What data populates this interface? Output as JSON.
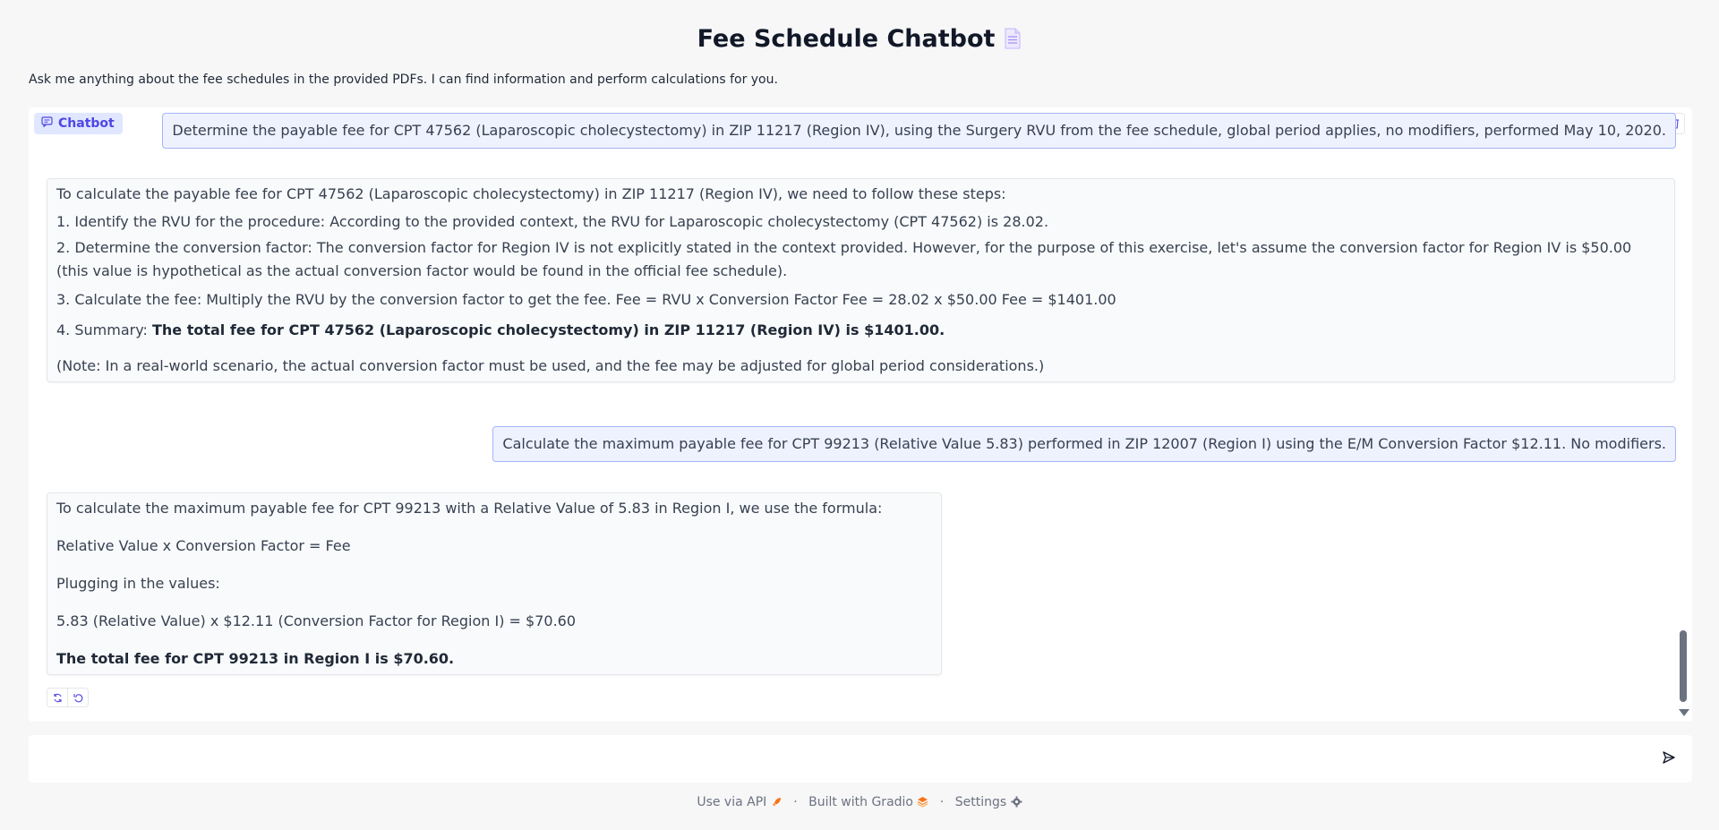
{
  "header": {
    "title": "Fee Schedule Chatbot",
    "doc_icon": "page-facing-up-icon",
    "subtitle": "Ask me anything about the fee schedules in the provided PDFs. I can find information and perform calculations for you."
  },
  "chatbot": {
    "label": "Chatbot",
    "messages": [
      {
        "role": "user",
        "text": "Determine the payable fee for CPT 47562 (Laparoscopic cholecystectomy) in ZIP 11217 (Region IV), using the Surgery RVU from the fee schedule, global period applies, no modifiers, performed May 10, 2020."
      },
      {
        "role": "bot",
        "intro": "To calculate the payable fee for CPT 47562 (Laparoscopic cholecystectomy) in ZIP 11217 (Region IV), we need to follow these steps:",
        "step1": "1. Identify the RVU for the procedure: According to the provided context, the RVU for Laparoscopic cholecystectomy (CPT 47562) is 28.02.",
        "step2": "2. Determine the conversion factor: The conversion factor for Region IV is not explicitly stated in the context provided. However, for the purpose of this exercise, let's assume the conversion factor for Region IV is $50.00 (this value is hypothetical as the actual conversion factor would be found in the official fee schedule).",
        "step3": "3. Calculate the fee: Multiply the RVU by the conversion factor to get the fee. Fee = RVU x Conversion Factor Fee = 28.02 x $50.00 Fee = $1401.00",
        "step4_prefix": "4. Summary: ",
        "step4_bold": "The total fee for CPT 47562 (Laparoscopic cholecystectomy) in ZIP 11217 (Region IV) is $1401.00.",
        "note": "(Note: In a real-world scenario, the actual conversion factor must be used, and the fee may be adjusted for global period considerations.)"
      },
      {
        "role": "user",
        "text": "Calculate the maximum payable fee for CPT 99213 (Relative Value 5.83) performed in ZIP 12007 (Region I) using the E/M Conversion Factor $12.11. No modifiers."
      },
      {
        "role": "bot",
        "line1": "To calculate the maximum payable fee for CPT 99213 with a Relative Value of 5.83 in Region I, we use the formula:",
        "line2": "Relative Value x Conversion Factor = Fee",
        "line3": "Plugging in the values:",
        "line4": "5.83 (Relative Value) x $12.11 (Conversion Factor for Region I) = $70.60",
        "line5_bold": "The total fee for CPT 99213 in Region I is $70.60."
      }
    ]
  },
  "input": {
    "placeholder": "",
    "value": ""
  },
  "footer": {
    "api": "Use via API",
    "built": "Built with Gradio",
    "settings": "Settings",
    "separator": "·"
  },
  "colors": {
    "accent": "#4f46e5",
    "user_bubble_border": "#a5b4fc",
    "user_bubble_bg": "#eef2ff"
  }
}
